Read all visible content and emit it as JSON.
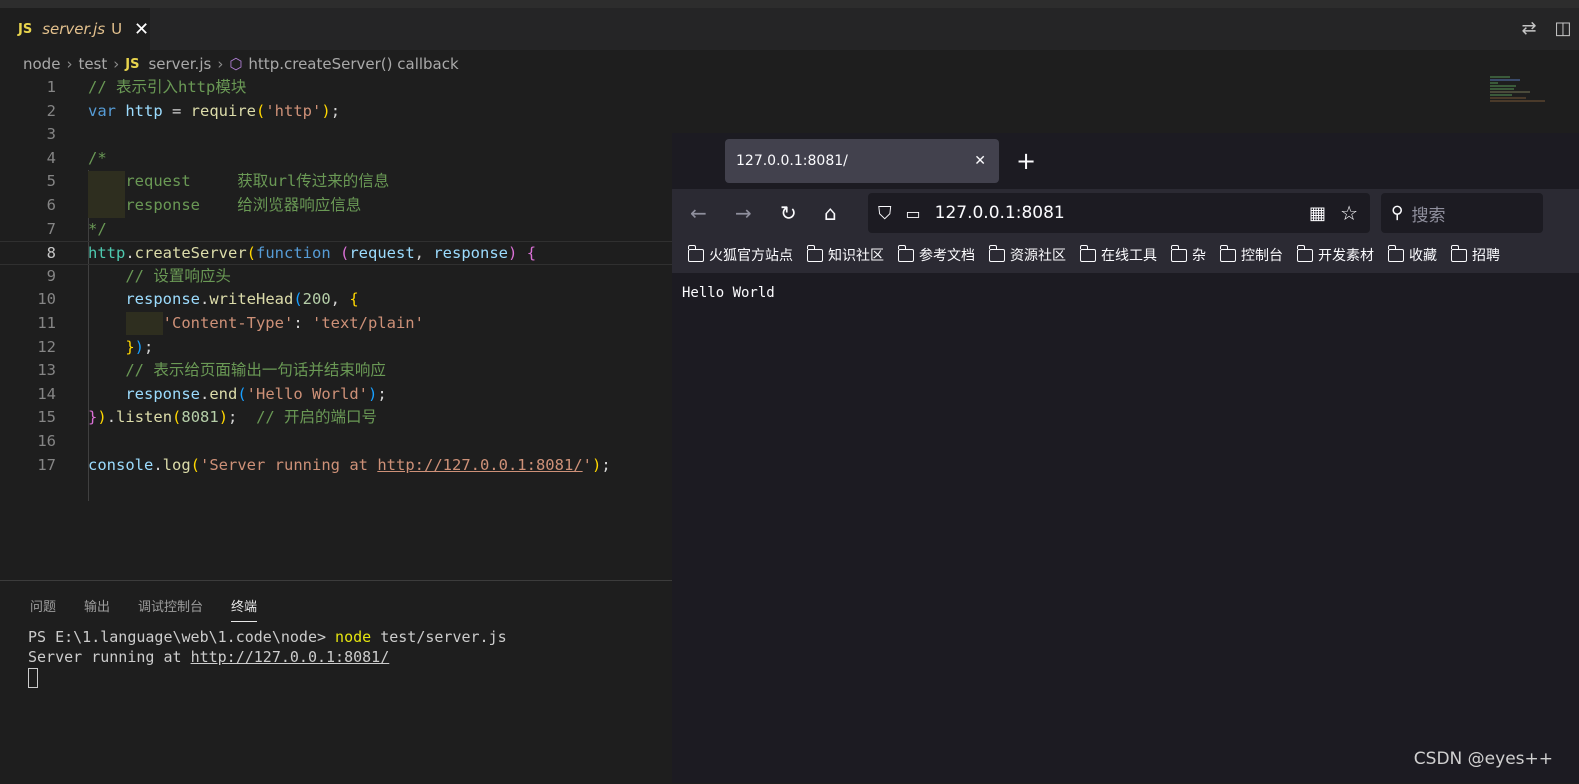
{
  "editor": {
    "tab": {
      "icon": "JS",
      "name": "server.js",
      "status": "U",
      "close": "✕"
    },
    "breadcrumb": {
      "folder1": "node",
      "folder2": "test",
      "file_icon": "JS",
      "file": "server.js",
      "symbol": "http.createServer() callback"
    },
    "lines": [
      {
        "n": "1"
      },
      {
        "n": "2"
      },
      {
        "n": "3"
      },
      {
        "n": "4"
      },
      {
        "n": "5"
      },
      {
        "n": "6"
      },
      {
        "n": "7"
      },
      {
        "n": "8"
      },
      {
        "n": "9"
      },
      {
        "n": "10"
      },
      {
        "n": "11"
      },
      {
        "n": "12"
      },
      {
        "n": "13"
      },
      {
        "n": "14"
      },
      {
        "n": "15"
      },
      {
        "n": "16"
      },
      {
        "n": "17"
      }
    ],
    "code": {
      "l1": "// 表示引入http模块",
      "l2_var": "var",
      "l2_http": "http",
      "l2_eq": " = ",
      "l2_require": "require",
      "l2_str": "'http'",
      "l2_end": ";",
      "l4": "/*",
      "l5": "    request     获取url传过来的信息",
      "l6": "    response    给浏览器响应信息",
      "l7": "*/",
      "l8_http": "http",
      "l8_dot": ".",
      "l8_create": "createServer",
      "l8_fn": "function",
      "l8_req": "request",
      "l8_comma": ", ",
      "l8_res": "response",
      "l9": "// 设置响应头",
      "l10_res": "response",
      "l10_dot": ".",
      "l10_wh": "writeHead",
      "l10_num": "200",
      "l10_comma": ", ",
      "l11_key": "'Content-Type'",
      "l11_colon": ": ",
      "l11_val": "'text/plain'",
      "l12": ";",
      "l13": "// 表示给页面输出一句话并结束响应",
      "l14_res": "response",
      "l14_dot": ".",
      "l14_end": "end",
      "l14_str": "'Hello World'",
      "l14_semi": ";",
      "l15_dot": ".",
      "l15_listen": "listen",
      "l15_num": "8081",
      "l15_semi": ";",
      "l15_cm": "// 开启的端口号",
      "l17_console": "console",
      "l17_dot": ".",
      "l17_log": "log",
      "l17_str1": "'Server running at ",
      "l17_link": "http://127.0.0.1:8081/",
      "l17_str2": "'",
      "l17_semi": ";"
    }
  },
  "panel": {
    "tabs": [
      "问题",
      "输出",
      "调试控制台",
      "终端"
    ],
    "active_tab": "终端",
    "terminal": {
      "prompt": "PS E:\\1.language\\web\\1.code\\node> ",
      "command": "node",
      "args": " test/server.js",
      "output_prefix": "Server running at ",
      "output_link": "http://127.0.0.1:8081/"
    }
  },
  "browser": {
    "tab_title": "127.0.0.1:8081/",
    "url": "127.0.0.1:8081",
    "search_placeholder": "搜索",
    "bookmarks": [
      "火狐官方站点",
      "知识社区",
      "参考文档",
      "资源社区",
      "在线工具",
      "杂",
      "控制台",
      "开发素材",
      "收藏",
      "招聘"
    ],
    "page_text": "Hello World"
  },
  "watermark": "CSDN @eyes++"
}
